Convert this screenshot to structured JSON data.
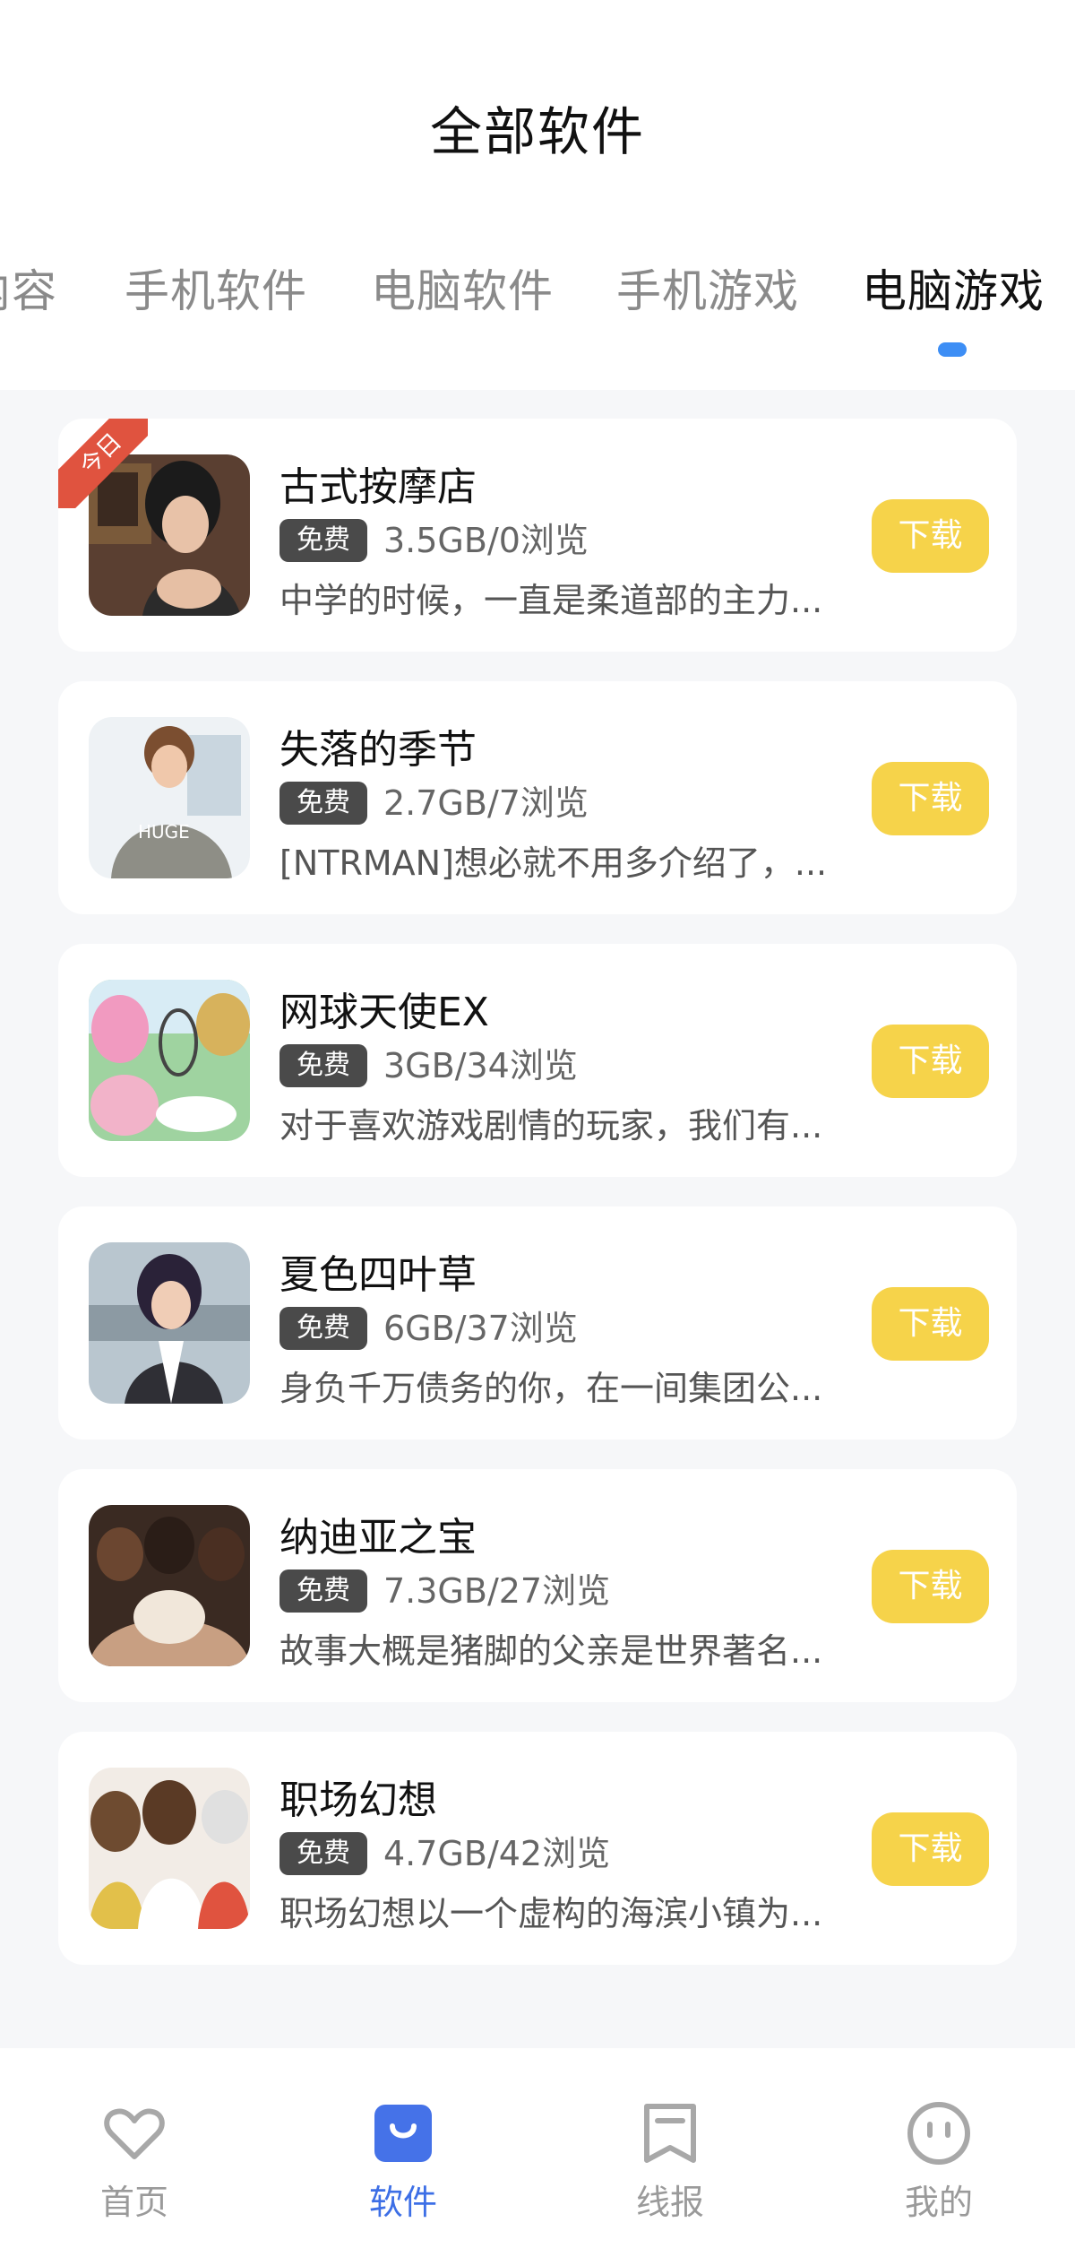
{
  "header": {
    "title": "全部软件"
  },
  "tabs": [
    {
      "label": "内容",
      "active": false
    },
    {
      "label": "手机软件",
      "active": false
    },
    {
      "label": "电脑软件",
      "active": false
    },
    {
      "label": "手机游戏",
      "active": false
    },
    {
      "label": "电脑游戏",
      "active": true
    }
  ],
  "colors": {
    "accent_blue": "#3d8ef5",
    "download_yellow": "#f6d34a",
    "ribbon_red": "#e0533f",
    "badge_gray": "#4a4a4a"
  },
  "items": [
    {
      "ribbon": "今日",
      "title": "古式按摩店",
      "badge": "免费",
      "stats": "3.5GB/0浏览",
      "desc": "中学的时候，一直是柔道部的主力...",
      "button": "下载"
    },
    {
      "ribbon": "",
      "title": "失落的季节",
      "badge": "免费",
      "stats": "2.7GB/7浏览",
      "desc": "[NTRMAN]想必就不用多介绍了，...",
      "button": "下载"
    },
    {
      "ribbon": "",
      "title": "网球天使EX",
      "badge": "免费",
      "stats": "3GB/34浏览",
      "desc": "对于喜欢游戏剧情的玩家，我们有...",
      "button": "下载"
    },
    {
      "ribbon": "",
      "title": "夏色四叶草",
      "badge": "免费",
      "stats": "6GB/37浏览",
      "desc": "身负千万债务的你，在一间集团公...",
      "button": "下载"
    },
    {
      "ribbon": "",
      "title": "纳迪亚之宝",
      "badge": "免费",
      "stats": "7.3GB/27浏览",
      "desc": "故事大概是猪脚的父亲是世界著名...",
      "button": "下载"
    },
    {
      "ribbon": "",
      "title": "职场幻想",
      "badge": "免费",
      "stats": "4.7GB/42浏览",
      "desc": "职场幻想以一个虚构的海滨小镇为...",
      "button": "下载"
    }
  ],
  "nav": [
    {
      "label": "首页",
      "icon": "heart-icon",
      "active": false
    },
    {
      "label": "软件",
      "icon": "shopping-bag-icon",
      "active": true
    },
    {
      "label": "线报",
      "icon": "bookmark-icon",
      "active": false
    },
    {
      "label": "我的",
      "icon": "face-icon",
      "active": false
    }
  ]
}
